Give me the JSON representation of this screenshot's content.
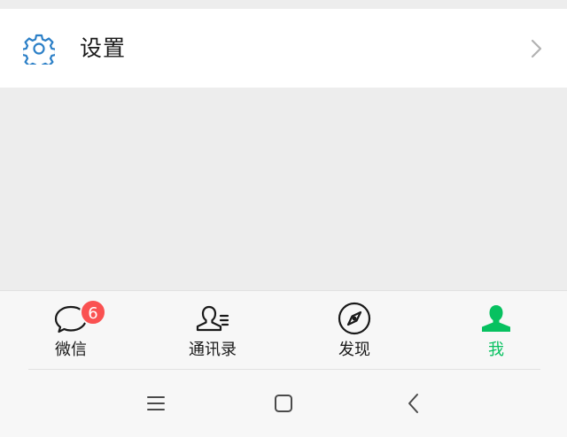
{
  "settings": {
    "label": "设置",
    "icon": "gear-icon",
    "accent_color": "#2b7fc7"
  },
  "tabbar": {
    "tabs": [
      {
        "label": "微信",
        "icon": "chat-bubble-icon",
        "badge": "6",
        "active": false
      },
      {
        "label": "通讯录",
        "icon": "contacts-icon",
        "active": false
      },
      {
        "label": "发现",
        "icon": "compass-icon",
        "active": false
      },
      {
        "label": "我",
        "icon": "person-icon",
        "active": true
      }
    ],
    "active_color": "#07c160",
    "badge_color": "#fa5151"
  },
  "system_nav": {
    "buttons": [
      "menu-icon",
      "home-icon",
      "back-icon"
    ]
  }
}
